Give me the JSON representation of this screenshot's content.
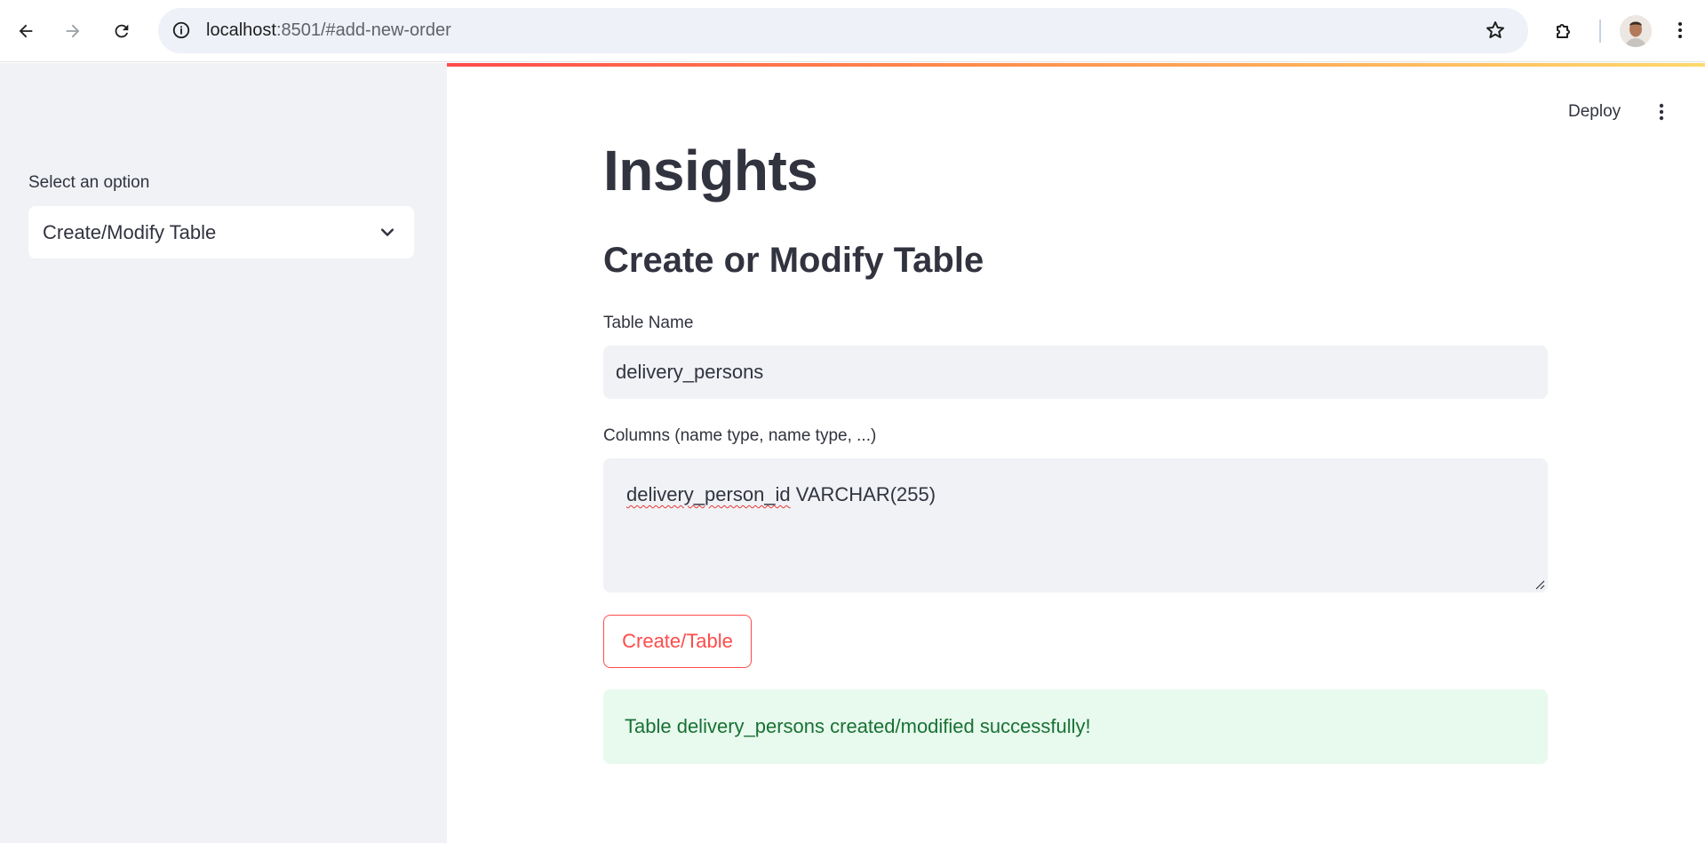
{
  "browser": {
    "url_host": "localhost",
    "url_path": ":8501/#add-new-order",
    "icons": [
      "back-arrow-icon",
      "forward-arrow-icon",
      "reload-icon",
      "info-icon",
      "star-icon",
      "extensions-icon",
      "avatar",
      "kebab-menu-icon"
    ]
  },
  "sidebar": {
    "select_label": "Select an option",
    "select_value": "Create/Modify Table"
  },
  "header": {
    "deploy_label": "Deploy"
  },
  "main": {
    "title": "Insights",
    "subtitle": "Create or Modify Table",
    "table_name_label": "Table Name",
    "table_name_value": "delivery_persons",
    "columns_label": "Columns (name type, name type, ...)",
    "columns_value_misspelled": "delivery_person_id",
    "columns_value_rest": " VARCHAR(255)",
    "submit_label": "Create/Table",
    "success_message": "Table delivery_persons created/modified successfully!"
  },
  "colors": {
    "accent": "#ff4b4b",
    "sidebar_bg": "#f0f2f6",
    "success_bg": "#e8f9ee",
    "success_text": "#177233",
    "text": "#31333f"
  }
}
